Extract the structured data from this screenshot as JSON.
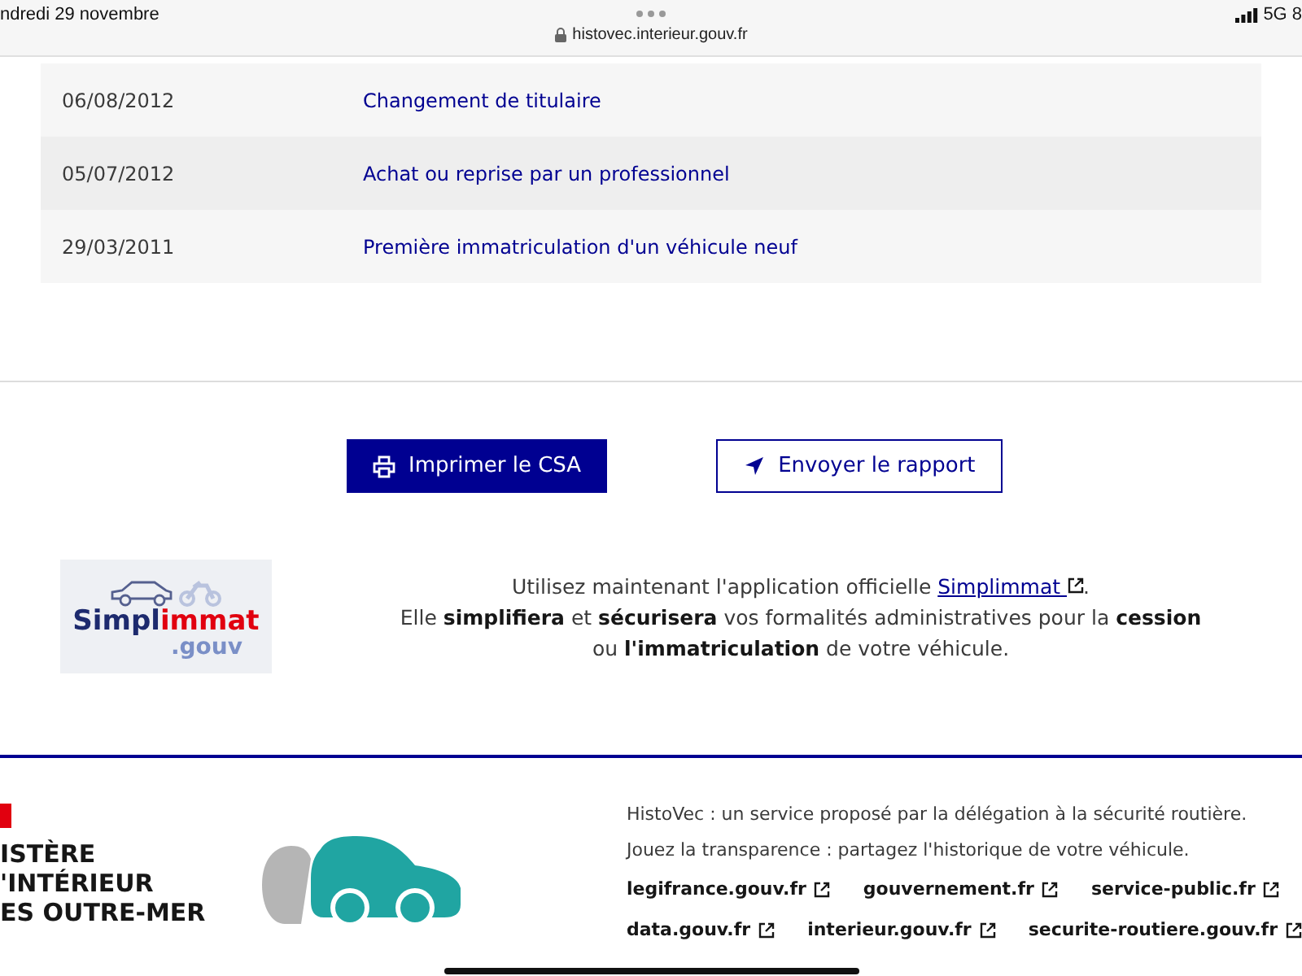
{
  "status_bar": {
    "date": "ndredi 29 novembre",
    "url": "histovec.interieur.gouv.fr",
    "network": "5G",
    "battery": "8"
  },
  "history": [
    {
      "date": "06/08/2012",
      "event": "Changement de titulaire"
    },
    {
      "date": "05/07/2012",
      "event": "Achat ou reprise par un professionnel"
    },
    {
      "date": "29/03/2011",
      "event": "Première immatriculation d'un véhicule neuf"
    }
  ],
  "actions": [
    {
      "kind": "primary",
      "label": "Imprimer le CSA"
    },
    {
      "kind": "secondary",
      "label": "Envoyer le rapport"
    }
  ],
  "promo": {
    "logo": {
      "name": "Simpl",
      "accent": "immat",
      "suffix": ".gouv"
    },
    "intro": "Utilisez maintenant l'application officielle ",
    "link": "Simplimmat",
    "after_link": ".",
    "body": "Elle **simplifiera** et **sécurisera** vos formalités administratives pour la **cession** ou **l'immatriculation** de votre véhicule."
  },
  "footer": {
    "brand": [
      "ISTÈRE",
      "'INTÉRIEUR",
      "ES OUTRE-MER"
    ],
    "description": [
      "HistoVec : un service proposé par la délégation à la sécurité routière.",
      "Jouez la transparence : partagez l'historique de votre véhicule."
    ],
    "links": [
      [
        "legifrance.gouv.fr",
        "gouvernement.fr",
        "service-public.fr"
      ],
      [
        "data.gouv.fr",
        "interieur.gouv.fr",
        "securite-routiere.gouv.fr"
      ]
    ]
  }
}
